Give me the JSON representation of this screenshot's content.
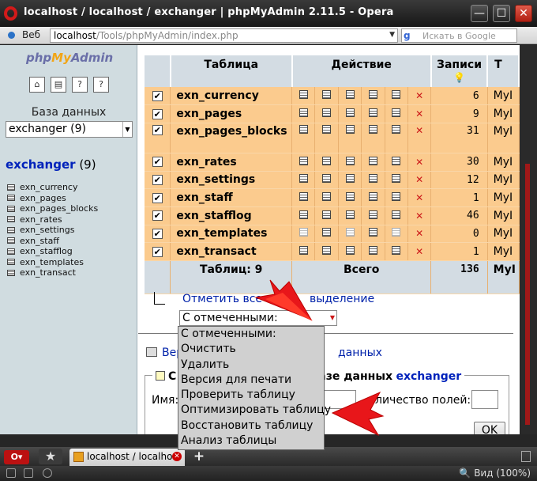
{
  "window": {
    "title": "localhost / localhost / exchanger | phpMyAdmin 2.11.5 - Opera",
    "min_icon": "minimize-icon",
    "max_icon": "maximize-icon",
    "close_icon": "close-icon",
    "min_glyph": "—",
    "max_glyph": "☐",
    "close_glyph": "✕"
  },
  "address": {
    "web_label": "Веб",
    "url_host": "localhost",
    "url_path": "/Tools/phpMyAdmin/index.php",
    "search_placeholder": "Искать в Google",
    "google_glyph": "g"
  },
  "left": {
    "logo_php": "php",
    "logo_my": "My",
    "logo_admin": "Admin",
    "db_label": "База данных",
    "db_selected": "exchanger (9)",
    "db_name": "exchanger",
    "db_count": "(9)",
    "tables": [
      "exn_currency",
      "exn_pages",
      "exn_pages_blocks",
      "exn_rates",
      "exn_settings",
      "exn_staff",
      "exn_stafflog",
      "exn_templates",
      "exn_transact"
    ]
  },
  "table": {
    "headers": {
      "table": "Таблица",
      "action": "Действие",
      "records": "Записи",
      "type": "Т"
    },
    "rows": [
      {
        "name": "exn_currency",
        "records": "6",
        "type": "MyI"
      },
      {
        "name": "exn_pages",
        "records": "9",
        "type": "MyI"
      },
      {
        "name": "exn_pages_blocks",
        "records": "31",
        "type": "MyI"
      },
      {
        "name": "exn_rates",
        "records": "30",
        "type": "MyI"
      },
      {
        "name": "exn_settings",
        "records": "12",
        "type": "MyI"
      },
      {
        "name": "exn_staff",
        "records": "1",
        "type": "MyI"
      },
      {
        "name": "exn_stafflog",
        "records": "46",
        "type": "MyI"
      },
      {
        "name": "exn_templates",
        "records": "0",
        "type": "MyI"
      },
      {
        "name": "exn_transact",
        "records": "1",
        "type": "MyI"
      }
    ],
    "total": {
      "tables": "Таблиц: 9",
      "label": "Всего",
      "records": "136",
      "type": "MyI"
    },
    "check_glyph": "✔",
    "delete_glyph": "✕"
  },
  "bulk": {
    "mark_all_link": "Отметить все / снять выделение",
    "mark_all_visible": "Отметить все",
    "mark_all_tail": "выделение",
    "with_selected": "С отмеченными:",
    "options": [
      "С отмеченными:",
      "Очистить",
      "Удалить",
      "Версия для печати",
      "Проверить таблицу",
      "Оптимизировать таблицу",
      "Восстановить таблицу",
      "Анализ таблицы"
    ]
  },
  "links": {
    "print_prefix": "Вер",
    "dict_suffix": "данных"
  },
  "create": {
    "legend_prefix": "С",
    "legend_mid": "азе данных",
    "legend_db": "exchanger",
    "name_label": "Имя:",
    "fields_label": "личество полей:",
    "ok": "OK"
  },
  "taskbar": {
    "tab_title": "localhost / localho...",
    "new_tab": "+",
    "star": "★",
    "zoom": "Вид (100%)"
  },
  "colors": {
    "row": "#fbcb8e",
    "header": "#d3dce3",
    "link": "#0022aa",
    "arrow": "#e8161a"
  }
}
